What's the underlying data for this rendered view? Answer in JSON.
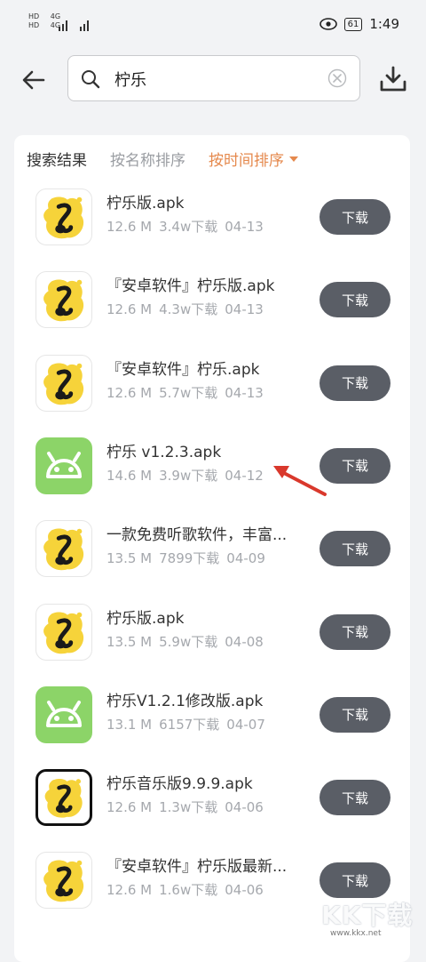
{
  "status_bar": {
    "left_labels": [
      "HD",
      "HD",
      "4G",
      "4G"
    ],
    "battery": "61",
    "time": "1:49"
  },
  "search": {
    "value": "柠乐",
    "placeholder": ""
  },
  "tabs": {
    "results": "搜索结果",
    "by_name": "按名称排序",
    "by_time": "按时间排序"
  },
  "items": [
    {
      "name": "柠乐版.apk",
      "size": "12.6 M",
      "downloads": "3.4w下载",
      "date": "04-13",
      "icon": "ning-icon",
      "button": "下载"
    },
    {
      "name": "『安卓软件』柠乐版.apk",
      "size": "12.6 M",
      "downloads": "4.3w下载",
      "date": "04-13",
      "icon": "ning-icon",
      "button": "下载"
    },
    {
      "name": "『安卓软件』柠乐.apk",
      "size": "12.6 M",
      "downloads": "5.7w下载",
      "date": "04-13",
      "icon": "ning-icon",
      "button": "下载"
    },
    {
      "name": "柠乐 v1.2.3.apk",
      "size": "14.6 M",
      "downloads": "3.9w下载",
      "date": "04-12",
      "icon": "android-icon",
      "button": "下载"
    },
    {
      "name": "一款免费听歌软件，丰富...",
      "size": "13.5 M",
      "downloads": "7899下载",
      "date": "04-09",
      "icon": "ning-icon",
      "button": "下载"
    },
    {
      "name": "柠乐版.apk",
      "size": "13.5 M",
      "downloads": "5.9w下载",
      "date": "04-08",
      "icon": "ning-icon",
      "button": "下载"
    },
    {
      "name": "柠乐V1.2.1修改版.apk",
      "size": "13.1 M",
      "downloads": "6157下载",
      "date": "04-07",
      "icon": "android-icon",
      "button": "下载"
    },
    {
      "name": "柠乐音乐版9.9.9.apk",
      "size": "12.6 M",
      "downloads": "1.3w下载",
      "date": "04-06",
      "icon": "ning-icon-outlined",
      "button": "下载"
    },
    {
      "name": "『安卓软件』柠乐版最新...",
      "size": "12.6 M",
      "downloads": "1.6w下载",
      "date": "04-06",
      "icon": "ning-icon",
      "button": "下载"
    }
  ],
  "watermark": {
    "brand": "KK下载",
    "url": "www.kkx.net"
  },
  "colors": {
    "accent": "#e5894d",
    "button": "#5a5e66",
    "android_green": "#8cd468",
    "ning_yellow": "#f6d33a"
  }
}
